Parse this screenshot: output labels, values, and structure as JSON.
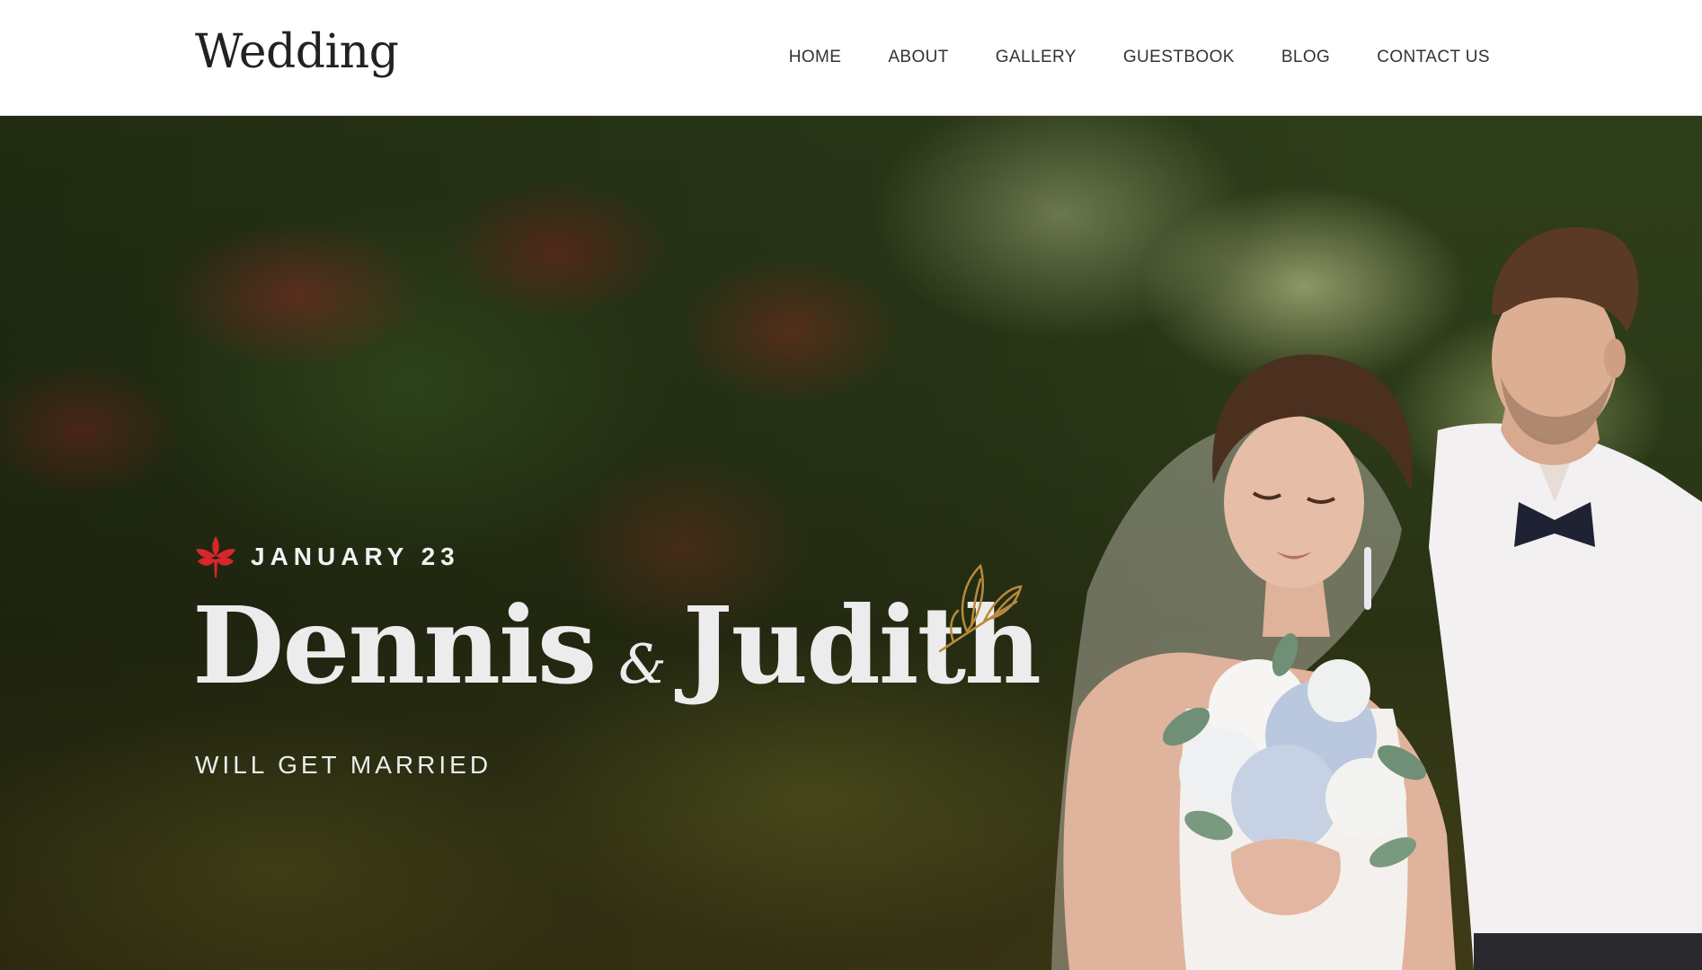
{
  "header": {
    "logo": "Wedding",
    "nav": [
      {
        "label": "HOME"
      },
      {
        "label": "ABOUT"
      },
      {
        "label": "GALLERY"
      },
      {
        "label": "GUESTBOOK"
      },
      {
        "label": "BLOG"
      },
      {
        "label": "CONTACT US"
      }
    ]
  },
  "hero": {
    "date": "JANUARY 23",
    "name_one": "Dennis",
    "ampersand": "&",
    "name_two": "Judith",
    "subtitle": "WILL GET MARRIED",
    "date_icon": "red-leaf-icon",
    "decor_icon": "gold-leaf-icon",
    "colors": {
      "accent_red": "#d8262b",
      "accent_gold": "#b88a3c",
      "text_light": "#ececec"
    }
  }
}
